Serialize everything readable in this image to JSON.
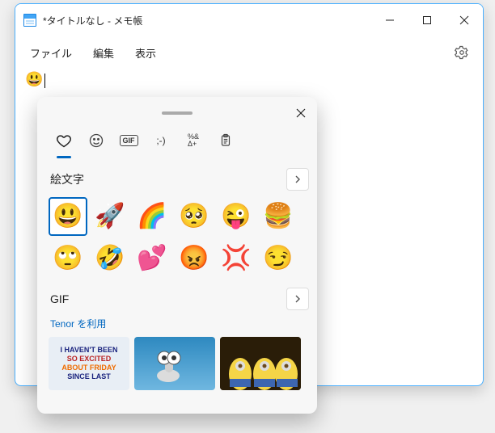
{
  "window": {
    "title": "*タイトルなし - メモ帳"
  },
  "menu": {
    "file": "ファイル",
    "edit": "編集",
    "view": "表示"
  },
  "editor": {
    "content_emoji": "😃"
  },
  "picker": {
    "tabs": {
      "recent_name": "recent",
      "emoji_name": "emoji",
      "gif_label": "GIF",
      "kaomoji_label": ";-)",
      "symbols_label": "%&\nΔ+",
      "clipboard_name": "clipboard"
    },
    "sections": {
      "emoji_title": "絵文字",
      "gif_title": "GIF",
      "gif_provider": "Tenor を利用"
    },
    "emoji_items": [
      "😃",
      "🚀",
      "🌈",
      "🥺",
      "😜",
      "🍔",
      "🙄",
      "🤣",
      "💕",
      "😡",
      "💢",
      "😏"
    ],
    "gif_thumbs": {
      "thumb1_line1": "I HAVEN'T BEEN",
      "thumb1_line2": "SO EXCITED",
      "thumb1_line3": "ABOUT FRIDAY",
      "thumb1_line4": "SINCE LAST"
    }
  }
}
